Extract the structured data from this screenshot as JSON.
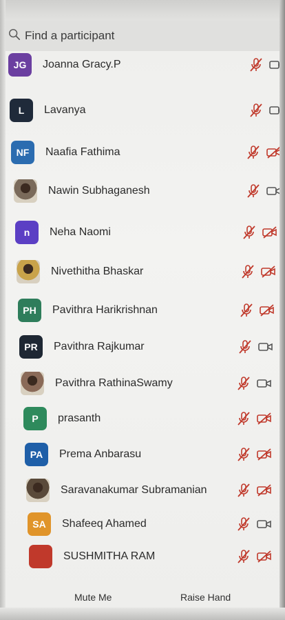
{
  "search": {
    "placeholder": "Find a participant"
  },
  "participants": [
    {
      "name": "Joanna Gracy.P",
      "initials": "JG",
      "color": "#6b3fa0",
      "avatar_type": "initials",
      "mic": "muted",
      "video": "off_plain"
    },
    {
      "name": "Lavanya",
      "initials": "L",
      "color": "#1f2a3a",
      "avatar_type": "initials",
      "mic": "muted",
      "video": "off_plain"
    },
    {
      "name": "Naafia Fathima",
      "initials": "NF",
      "color": "#2b6cb0",
      "avatar_type": "initials",
      "mic": "muted",
      "video": "off"
    },
    {
      "name": "Nawin Subhaganesh",
      "initials": "",
      "color": "#7a6a5a",
      "avatar_type": "photo",
      "mic": "muted",
      "video": "off_plain"
    },
    {
      "name": "Neha Naomi",
      "initials": "n",
      "color": "#5b3fc4",
      "avatar_type": "initials",
      "mic": "muted",
      "video": "off"
    },
    {
      "name": "Nivethitha Bhaskar",
      "initials": "",
      "color": "#c9a34a",
      "avatar_type": "photo",
      "mic": "muted",
      "video": "off"
    },
    {
      "name": "Pavithra Harikrishnan",
      "initials": "PH",
      "color": "#2e7d5b",
      "avatar_type": "initials",
      "mic": "muted",
      "video": "off"
    },
    {
      "name": "Pavithra Rajkumar",
      "initials": "PR",
      "color": "#1e2733",
      "avatar_type": "initials",
      "mic": "muted",
      "video": "off_plain"
    },
    {
      "name": "Pavithra RathinaSwamy",
      "initials": "",
      "color": "#8a6a58",
      "avatar_type": "photo",
      "mic": "muted",
      "video": "off_plain"
    },
    {
      "name": "prasanth",
      "initials": "P",
      "color": "#2e8a5c",
      "avatar_type": "initials",
      "mic": "muted",
      "video": "off"
    },
    {
      "name": "Prema Anbarasu",
      "initials": "PA",
      "color": "#1f5fa8",
      "avatar_type": "initials",
      "mic": "muted",
      "video": "off"
    },
    {
      "name": "Saravanakumar Subramanian",
      "initials": "",
      "color": "#5a4a3a",
      "avatar_type": "photo",
      "mic": "muted",
      "video": "off"
    },
    {
      "name": "Shafeeq Ahamed",
      "initials": "SA",
      "color": "#e0942a",
      "avatar_type": "initials",
      "mic": "muted",
      "video": "off_plain"
    },
    {
      "name": "SUSHMITHA RAM",
      "initials": "",
      "color": "#c0392b",
      "avatar_type": "initials",
      "mic": "muted",
      "video": "off"
    }
  ],
  "footer": {
    "mute_label": "Mute Me",
    "raise_hand_label": "Raise Hand"
  },
  "colors": {
    "muted_icon": "#c0392b",
    "video_icon": "#555555"
  }
}
